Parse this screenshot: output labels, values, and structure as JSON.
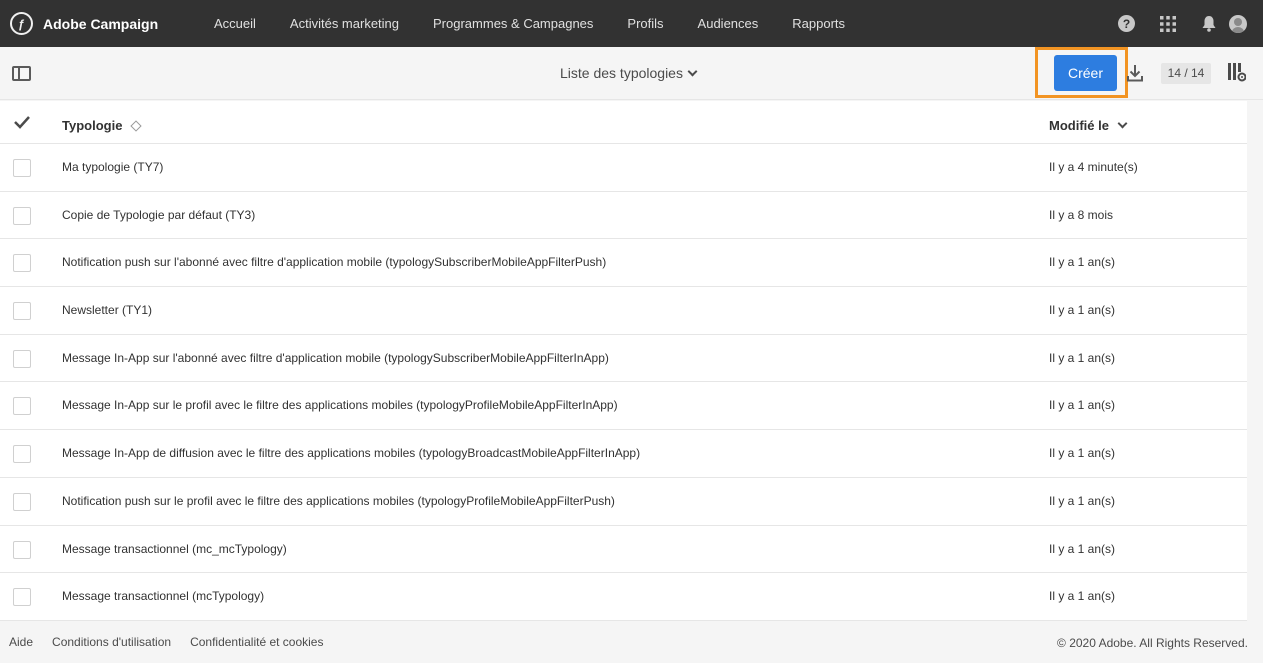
{
  "topnav": {
    "brand": "Adobe Campaign",
    "items": [
      {
        "label": "Accueil"
      },
      {
        "label": "Activités marketing"
      },
      {
        "label": "Programmes & Campagnes"
      },
      {
        "label": "Profils"
      },
      {
        "label": "Audiences"
      },
      {
        "label": "Rapports"
      }
    ],
    "help_glyph": "?"
  },
  "toolbar": {
    "title": "Liste des typologies",
    "create_label": "Créer",
    "count": "14 / 14"
  },
  "table": {
    "columns": {
      "name": "Typologie",
      "modified": "Modifié le"
    },
    "rows": [
      {
        "name": "Ma typologie (TY7)",
        "modified": "Il y a 4 minute(s)"
      },
      {
        "name": "Copie de Typologie par défaut (TY3)",
        "modified": "Il y a 8 mois"
      },
      {
        "name": "Notification push sur l'abonné avec filtre d'application mobile (typologySubscriberMobileAppFilterPush)",
        "modified": "Il y a 1 an(s)"
      },
      {
        "name": "Newsletter (TY1)",
        "modified": "Il y a 1 an(s)"
      },
      {
        "name": "Message In-App sur l'abonné avec filtre d'application mobile (typologySubscriberMobileAppFilterInApp)",
        "modified": "Il y a 1 an(s)"
      },
      {
        "name": "Message In-App sur le profil avec le filtre des applications mobiles (typologyProfileMobileAppFilterInApp)",
        "modified": "Il y a 1 an(s)"
      },
      {
        "name": "Message In-App de diffusion avec le filtre des applications mobiles (typologyBroadcastMobileAppFilterInApp)",
        "modified": "Il y a 1 an(s)"
      },
      {
        "name": "Notification push sur le profil avec le filtre des applications mobiles (typologyProfileMobileAppFilterPush)",
        "modified": "Il y a 1 an(s)"
      },
      {
        "name": "Message transactionnel (mc_mcTypology)",
        "modified": "Il y a 1 an(s)"
      },
      {
        "name": "Message transactionnel (mcTypology)",
        "modified": "Il y a 1 an(s)"
      }
    ]
  },
  "footer": {
    "links": [
      {
        "label": "Aide"
      },
      {
        "label": "Conditions d'utilisation"
      },
      {
        "label": "Confidentialité et cookies"
      }
    ],
    "copyright": "© 2020 Adobe. All Rights Reserved."
  },
  "colors": {
    "topnav_bg": "#323232",
    "create_button": "#2d7de0",
    "highlight": "#f29423"
  },
  "icons": [
    "adobe-campaign-logo-icon",
    "help-icon",
    "apps-grid-icon",
    "bell-icon",
    "avatar-icon",
    "panel-toggle-icon",
    "chevron-down-icon",
    "download-icon",
    "column-config-icon",
    "checkmark-icon",
    "sort-icon",
    "sort-down-icon"
  ]
}
